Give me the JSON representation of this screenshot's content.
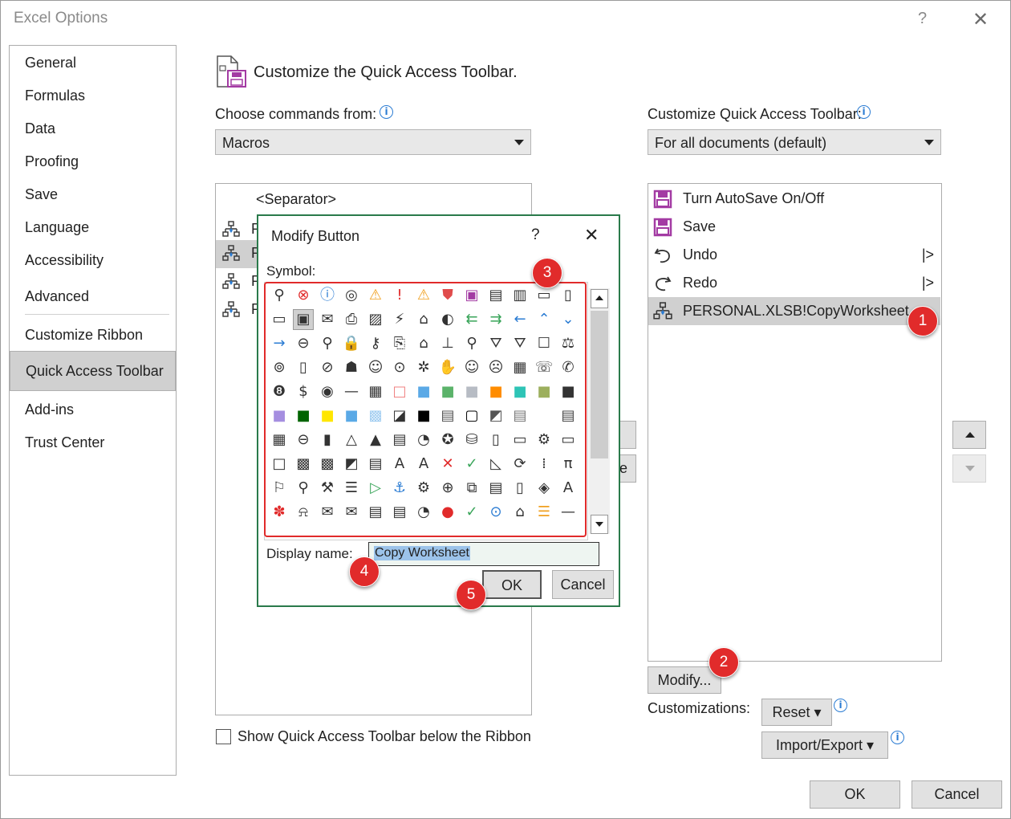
{
  "window": {
    "title": "Excel Options",
    "help": "?",
    "close": "✕"
  },
  "nav": {
    "items": [
      "General",
      "Formulas",
      "Data",
      "Proofing",
      "Save",
      "Language",
      "Accessibility",
      "Advanced",
      "Customize Ribbon",
      "Quick Access Toolbar",
      "Add-ins",
      "Trust Center"
    ],
    "selected": "Quick Access Toolbar"
  },
  "header": {
    "title": "Customize the Quick Access Toolbar."
  },
  "left": {
    "choose_label": "Choose commands from:",
    "choose_value": "Macros",
    "list_items": [
      "<Separator>"
    ],
    "list_truncated_prefix": "P",
    "show_below_label": "Show Quick Access Toolbar below the Ribbon"
  },
  "right": {
    "customize_label": "Customize Quick Access Toolbar:",
    "customize_value": "For all documents (default)",
    "items": [
      {
        "label": "Turn AutoSave On/Off",
        "icon": "save-purple-icon"
      },
      {
        "label": "Save",
        "icon": "save-purple-icon"
      },
      {
        "label": "Undo",
        "icon": "undo-icon",
        "submenu": "|>"
      },
      {
        "label": "Redo",
        "icon": "redo-icon",
        "submenu": "|>"
      },
      {
        "label": "PERSONAL.XLSB!CopyWorksheet",
        "icon": "macro-icon",
        "selected": true
      }
    ],
    "modify_button": "Modify...",
    "customizations_label": "Customizations:",
    "reset_button": "Reset ▾",
    "import_export_button": "Import/Export ▾"
  },
  "footer": {
    "ok": "OK",
    "cancel": "Cancel"
  },
  "dialog": {
    "title": "Modify Button",
    "help": "?",
    "close": "✕",
    "symbol_label": "Symbol:",
    "display_name_label": "Display name:",
    "display_name_value": "Copy Worksheet",
    "ok": "OK",
    "cancel": "Cancel",
    "partial_button_char": "e"
  },
  "badges": [
    "1",
    "2",
    "3",
    "4",
    "5"
  ],
  "colors": {
    "accent_red": "#e12b2b",
    "dialog_border": "#2a7a4b",
    "selection": "#d0d0d0",
    "info_blue": "#2b7cd3",
    "purple": "#a33ba3"
  }
}
